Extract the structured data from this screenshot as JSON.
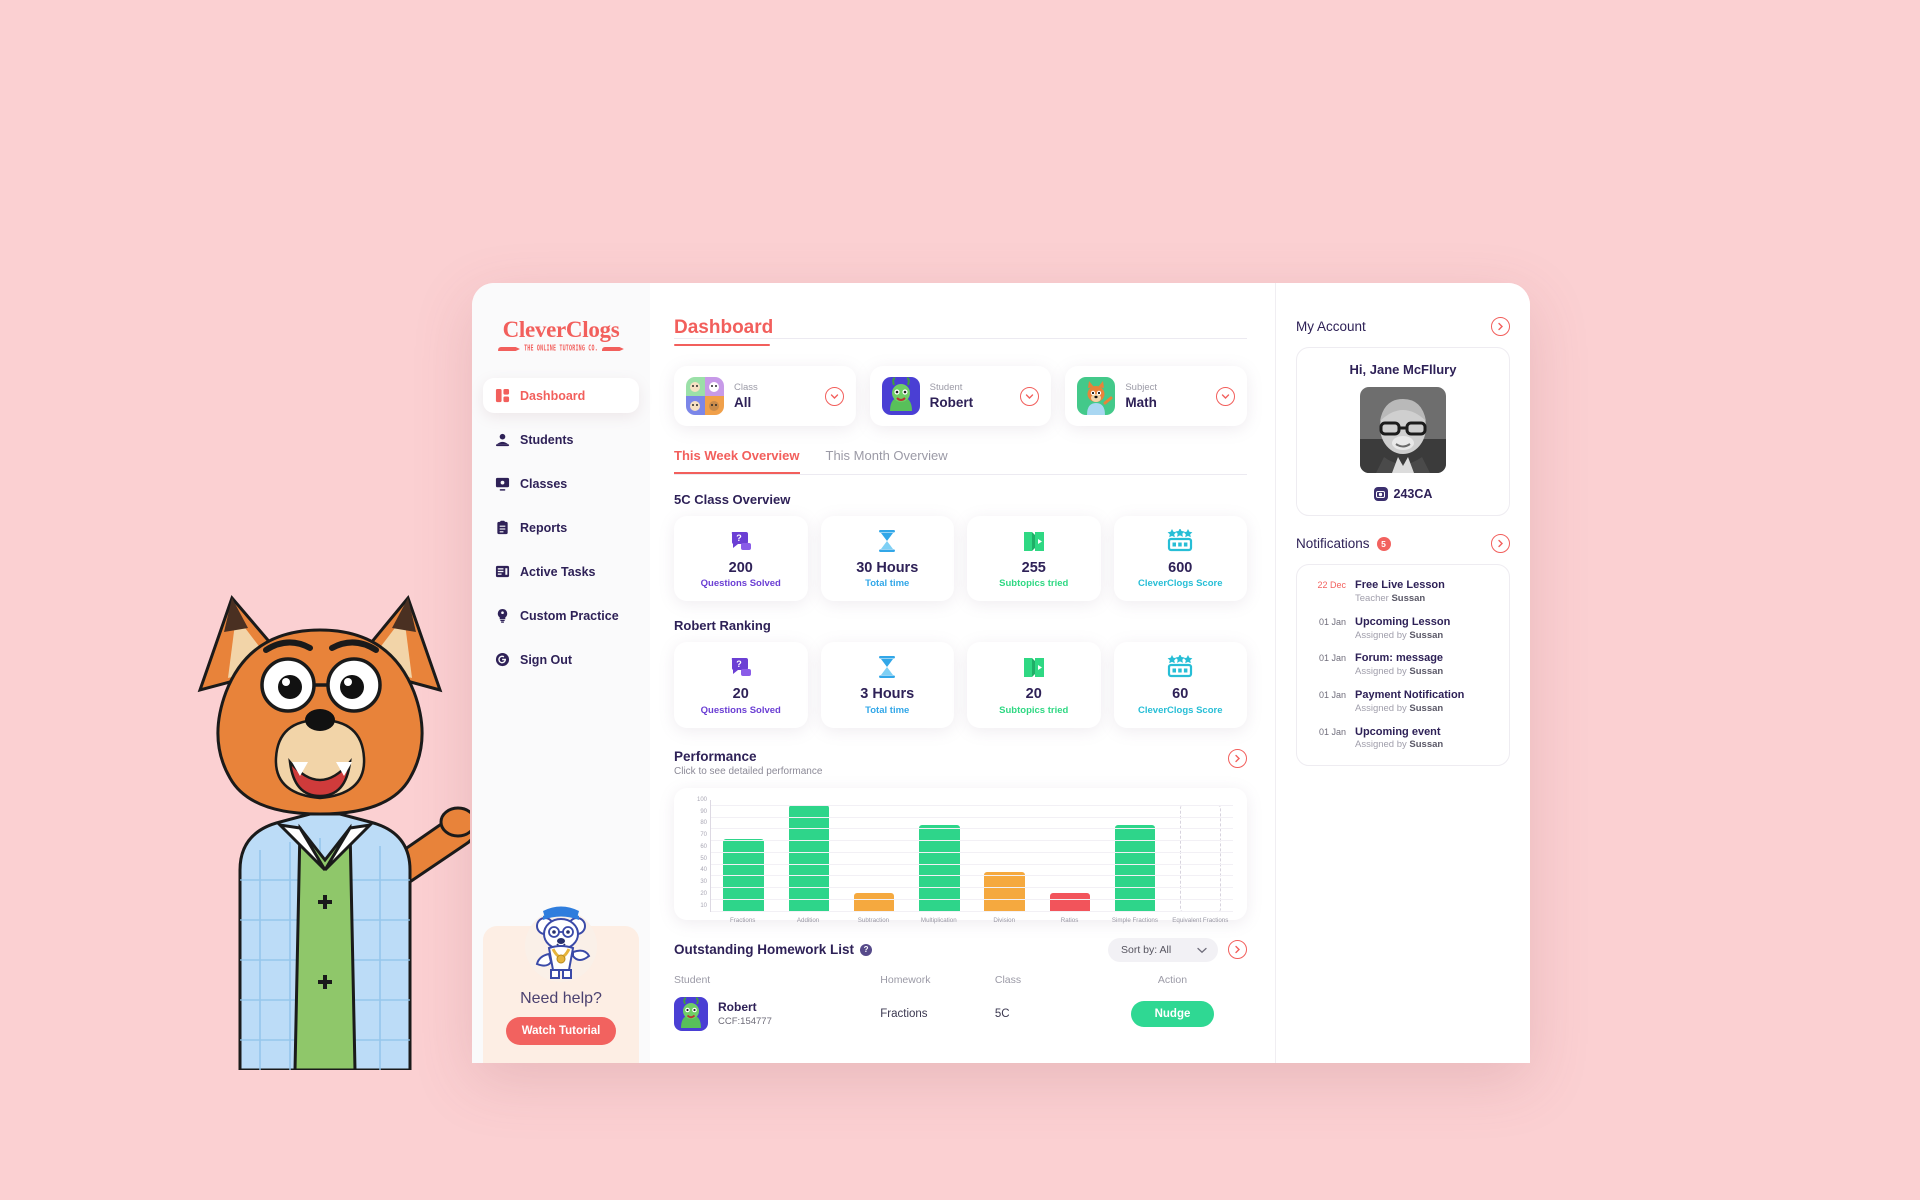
{
  "brand": {
    "name": "CleverClogs",
    "tagline": "THE ONLINE TUTORING CO.",
    "accent": "#f25f5c"
  },
  "sidebar": {
    "items": [
      {
        "label": "Dashboard",
        "icon": "dashboard-icon",
        "active": true
      },
      {
        "label": "Students",
        "icon": "students-icon",
        "active": false
      },
      {
        "label": "Classes",
        "icon": "classes-icon",
        "active": false
      },
      {
        "label": "Reports",
        "icon": "reports-icon",
        "active": false
      },
      {
        "label": "Active Tasks",
        "icon": "active-tasks-icon",
        "active": false
      },
      {
        "label": "Custom Practice",
        "icon": "custom-practice-icon",
        "active": false
      },
      {
        "label": "Sign Out",
        "icon": "sign-out-icon",
        "active": false
      }
    ],
    "help": {
      "title": "Need help?",
      "button": "Watch Tutorial"
    }
  },
  "header": {
    "title": "Dashboard"
  },
  "filters": [
    {
      "label": "Class",
      "value": "All",
      "avatar": "class-avatar"
    },
    {
      "label": "Student",
      "value": "Robert",
      "avatar": "student-avatar"
    },
    {
      "label": "Subject",
      "value": "Math",
      "avatar": "subject-avatar"
    }
  ],
  "tabs": [
    {
      "label": "This Week Overview",
      "active": true
    },
    {
      "label": "This Month Overview",
      "active": false
    }
  ],
  "class_overview": {
    "title": "5C Class Overview",
    "stats": [
      {
        "value": "200",
        "label": "Questions Solved",
        "color": "#6b3fd4",
        "icon": "question-bubble-icon"
      },
      {
        "value": "30 Hours",
        "label": "Total time",
        "color": "#32a7e8",
        "icon": "hourglass-icon"
      },
      {
        "value": "255",
        "label": "Subtopics tried",
        "color": "#2fd883",
        "icon": "open-book-icon"
      },
      {
        "value": "600",
        "label": "CleverClogs Score",
        "color": "#27bed6",
        "icon": "score-stars-icon"
      }
    ]
  },
  "student_ranking": {
    "title": "Robert Ranking",
    "stats": [
      {
        "value": "20",
        "label": "Questions Solved",
        "color": "#6b3fd4",
        "icon": "question-bubble-icon"
      },
      {
        "value": "3 Hours",
        "label": "Total time",
        "color": "#32a7e8",
        "icon": "hourglass-icon"
      },
      {
        "value": "20",
        "label": "Subtopics tried",
        "color": "#2fd883",
        "icon": "open-book-icon"
      },
      {
        "value": "60",
        "label": "CleverClogs Score",
        "color": "#27bed6",
        "icon": "score-stars-icon"
      }
    ]
  },
  "performance": {
    "title": "Performance",
    "subtitle": "Click to see detailed performance"
  },
  "chart_data": {
    "type": "bar",
    "title": "Performance",
    "xlabel": "",
    "ylabel": "",
    "ylim": [
      10,
      100
    ],
    "yticks": [
      100,
      90,
      80,
      70,
      60,
      50,
      40,
      30,
      20,
      10
    ],
    "grid": true,
    "legend": false,
    "categories": [
      "Fractions",
      "Addition",
      "Subtraction",
      "Multiplication",
      "Division",
      "Ratios",
      "Simple Fractions",
      "Equivalent Fractions"
    ],
    "values": [
      72,
      101,
      26,
      84,
      44,
      26,
      84,
      null
    ],
    "colors": [
      "#2ed58a",
      "#2ed58a",
      "#f5a93f",
      "#2ed58a",
      "#f5a93f",
      "#f2545b",
      "#2ed58a",
      "none"
    ],
    "empty_category": "Equivalent Fractions"
  },
  "homework": {
    "title": "Outstanding Homework List",
    "info_glyph": "?",
    "sort_label": "Sort by: All",
    "sort_options": [
      "Sort by: All"
    ],
    "columns": [
      "Student",
      "Homework",
      "Class",
      "Action"
    ],
    "rows": [
      {
        "student_name": "Robert",
        "student_id": "CCF:154777",
        "homework": "Fractions",
        "class": "5C",
        "action": "Nudge"
      }
    ]
  },
  "account": {
    "section_title": "My Account",
    "greeting": "Hi, Jane McFllury",
    "code": "243CA"
  },
  "notifications": {
    "section_title": "Notifications",
    "badge": "5",
    "items": [
      {
        "date": "22 Dec",
        "title": "Free Live Lesson",
        "sub_prefix": "Teacher",
        "sub_name": "Sussan",
        "hot": true
      },
      {
        "date": "01 Jan",
        "title": "Upcoming Lesson",
        "sub_prefix": "Assigned by",
        "sub_name": "Sussan",
        "hot": false
      },
      {
        "date": "01 Jan",
        "title": "Forum: message",
        "sub_prefix": "Assigned by",
        "sub_name": "Sussan",
        "hot": false
      },
      {
        "date": "01 Jan",
        "title": "Payment Notification",
        "sub_prefix": "Assigned by",
        "sub_name": "Sussan",
        "hot": false
      },
      {
        "date": "01 Jan",
        "title": "Upcoming event",
        "sub_prefix": "Assigned by",
        "sub_name": "Sussan",
        "hot": false
      }
    ]
  }
}
